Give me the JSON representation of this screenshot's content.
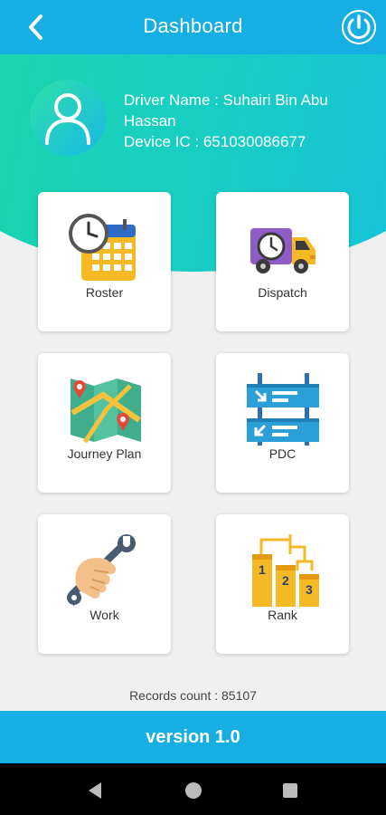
{
  "header": {
    "title": "Dashboard",
    "back_icon": "chevron-left-icon",
    "power_icon": "power-icon"
  },
  "driver": {
    "name_line": "Driver Name : Suhairi Bin Abu Hassan",
    "device_line": "Device IC : 651030086677",
    "avatar_icon": "user-icon"
  },
  "menu": [
    {
      "label": "Roster",
      "icon": "calendar-clock-icon"
    },
    {
      "label": "Dispatch",
      "icon": "truck-clock-icon"
    },
    {
      "label": "Journey Plan",
      "icon": "map-pins-icon"
    },
    {
      "label": "PDC",
      "icon": "signpost-icon"
    },
    {
      "label": "Work",
      "icon": "hand-wrench-icon"
    },
    {
      "label": "Rank",
      "icon": "podium-icon"
    }
  ],
  "footer": {
    "records": "Records count : 85107",
    "version": "version 1.0"
  },
  "colors": {
    "primary": "#16aee3",
    "gradient_start": "#1ad6a6",
    "gradient_end": "#16c2dc"
  }
}
